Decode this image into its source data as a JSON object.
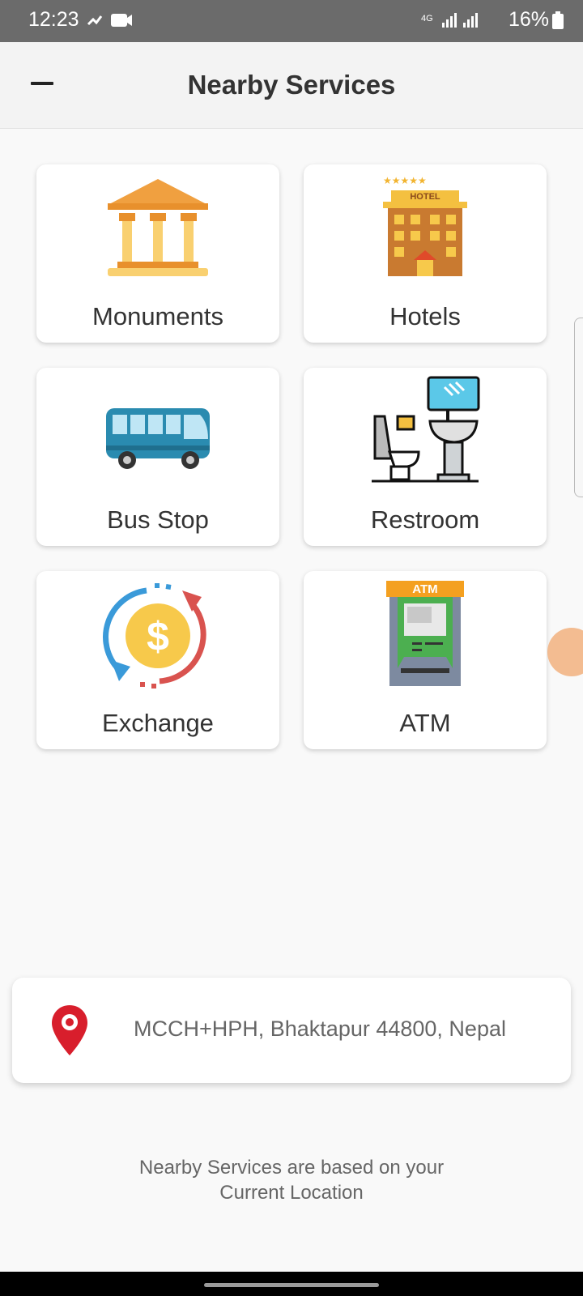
{
  "status_bar": {
    "time": "12:23",
    "battery": "16%",
    "network": "4G"
  },
  "app_bar": {
    "title": "Nearby Services",
    "menu_icon": "minus-icon"
  },
  "services": [
    {
      "label": "Monuments",
      "icon": "monument-icon"
    },
    {
      "label": "Hotels",
      "icon": "hotel-icon"
    },
    {
      "label": "Bus Stop",
      "icon": "bus-icon"
    },
    {
      "label": "Restroom",
      "icon": "restroom-icon"
    },
    {
      "label": "Exchange",
      "icon": "currency-exchange-icon"
    },
    {
      "label": "ATM",
      "icon": "atm-icon"
    }
  ],
  "icon_labels": {
    "hotel_sign": "HOTEL",
    "atm_sign": "ATM"
  },
  "location": {
    "address": "MCCH+HPH, Bhaktapur 44800, Nepal",
    "icon": "location-pin-icon"
  },
  "footer_note": {
    "line1": "Nearby Services are based on your",
    "line2": "Current Location"
  },
  "colors": {
    "status_bar": "#6b6b6b",
    "pin": "#d81e2c"
  }
}
